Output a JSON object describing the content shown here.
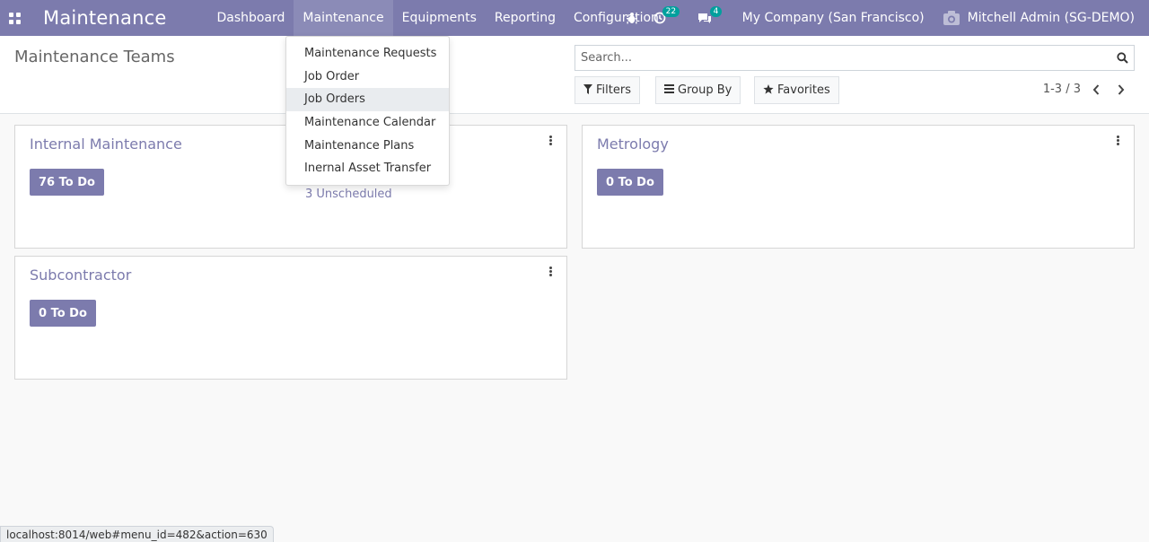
{
  "navbar": {
    "app_title": "Maintenance",
    "menu": [
      "Dashboard",
      "Maintenance",
      "Equipments",
      "Reporting",
      "Configuration"
    ],
    "activity_count": "22",
    "messages_count": "4",
    "company": "My Company (San Francisco)",
    "user": "Mitchell Admin (SG-DEMO)"
  },
  "control": {
    "title": "Maintenance Teams",
    "search_placeholder": "Search...",
    "filters_label": "Filters",
    "groupby_label": "Group By",
    "favorites_label": "Favorites",
    "pager": "1-3 / 3"
  },
  "dropdown": {
    "items": [
      "Maintenance Requests",
      "Job Order",
      "Job Orders",
      "Maintenance Calendar",
      "Maintenance Plans",
      "Inernal Asset Transfer"
    ]
  },
  "teams": [
    {
      "name": "Internal Maintenance",
      "todo": "76 To Do",
      "unscheduled": "3 Unscheduled"
    },
    {
      "name": "Metrology",
      "todo": "0 To Do"
    },
    {
      "name": "Subcontractor",
      "todo": "0 To Do"
    }
  ],
  "statusbar": {
    "url": "localhost:8014/web#menu_id=482&action=630"
  },
  "colors": {
    "brand": "#7c7bad",
    "badge": "#00a09d"
  }
}
